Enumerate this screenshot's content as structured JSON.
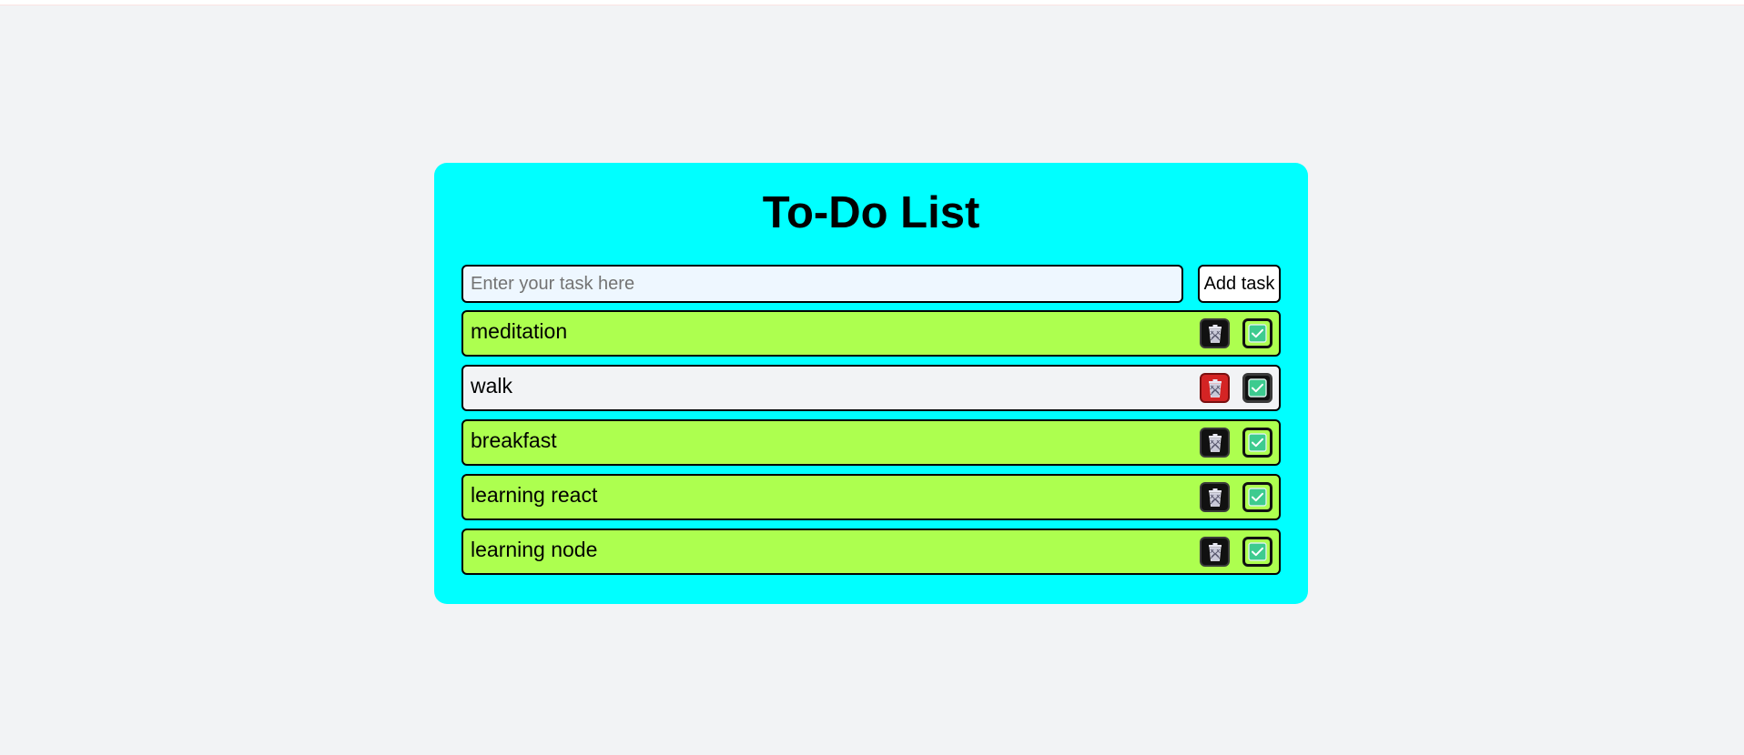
{
  "app": {
    "title": "To-Do List"
  },
  "input": {
    "placeholder": "Enter your task here",
    "value": ""
  },
  "add_button": {
    "label": "Add task"
  },
  "colors": {
    "background": "#f2f3f5",
    "card": "#00ffff",
    "task_pending": "#adff4f",
    "task_highlight": "#f2f3f5",
    "delete_danger": "#d42424",
    "check_green": "#3dcb8f"
  },
  "tasks": [
    {
      "text": "meditation",
      "state": "pending",
      "delete_icon": "trash-icon",
      "complete_icon": "checkbox-icon"
    },
    {
      "text": "walk",
      "state": "highlighted",
      "delete_icon": "trash-icon",
      "complete_icon": "checkbox-icon"
    },
    {
      "text": "breakfast",
      "state": "pending",
      "delete_icon": "trash-icon",
      "complete_icon": "checkbox-icon"
    },
    {
      "text": "learning react",
      "state": "pending",
      "delete_icon": "trash-icon",
      "complete_icon": "checkbox-icon"
    },
    {
      "text": "learning node",
      "state": "pending",
      "delete_icon": "trash-icon",
      "complete_icon": "checkbox-icon"
    }
  ]
}
